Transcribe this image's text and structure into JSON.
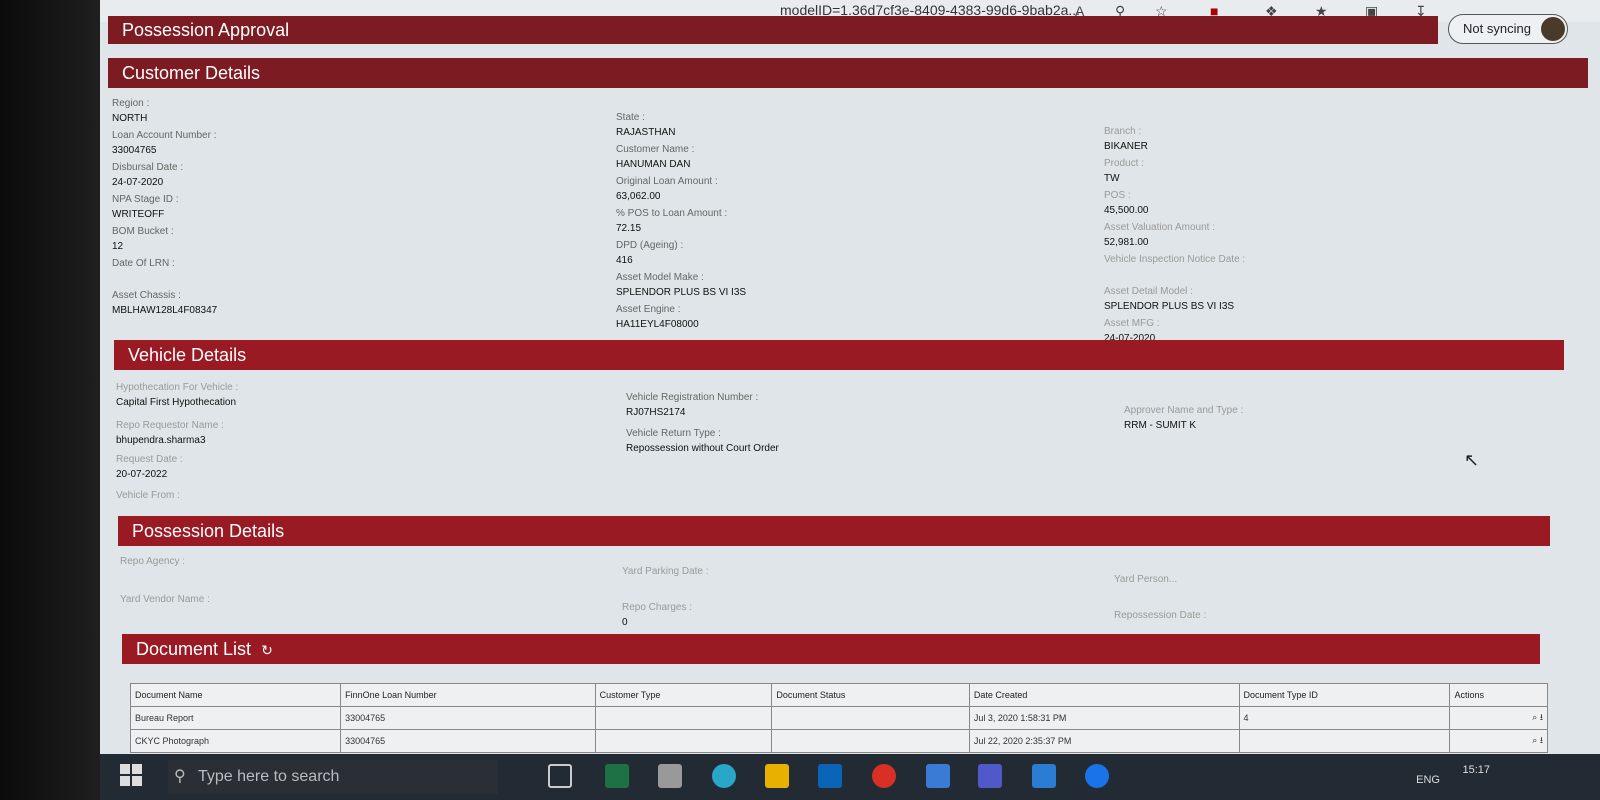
{
  "browser": {
    "url": "modelID=1.36d7cf3e-8409-4383-99d6-9bab2a...",
    "sync_label": "Not syncing"
  },
  "page": {
    "title": "Possession Approval",
    "customer": {
      "header": "Customer Details",
      "col1": [
        [
          "Region :",
          "NORTH"
        ],
        [
          "Loan Account Number :",
          "33004765"
        ],
        [
          "Disbursal Date :",
          "24-07-2020"
        ],
        [
          "NPA Stage ID :",
          "WRITEOFF"
        ],
        [
          "BOM Bucket :",
          "12"
        ],
        [
          "Date Of LRN :",
          ""
        ],
        [
          "Asset Chassis :",
          "MBLHAW128L4F08347"
        ]
      ],
      "col2": [
        [
          "State :",
          "RAJASTHAN"
        ],
        [
          "Customer Name :",
          "HANUMAN DAN"
        ],
        [
          "Original Loan Amount :",
          "63,062.00"
        ],
        [
          "% POS to Loan Amount :",
          "72.15"
        ],
        [
          "DPD (Ageing) :",
          "416"
        ],
        [
          "Asset Model Make :",
          "SPLENDOR PLUS BS VI I3S"
        ],
        [
          "Asset Engine :",
          "HA11EYL4F08000"
        ]
      ],
      "col3": [
        [
          "Branch :",
          "BIKANER"
        ],
        [
          "Product :",
          "TW"
        ],
        [
          "POS :",
          "45,500.00"
        ],
        [
          "Asset Valuation Amount :",
          "52,981.00"
        ],
        [
          "Vehicle Inspection Notice Date :",
          ""
        ],
        [
          "Asset Detail Model :",
          "SPLENDOR PLUS BS VI I3S"
        ],
        [
          "Asset MFG :",
          "24-07-2020"
        ]
      ]
    },
    "vehicle": {
      "header": "Vehicle Details",
      "hyp_label": "Hypothecation For Vehicle :",
      "hyp_value": "Capital First Hypothecation",
      "req_label": "Repo Requestor Name :",
      "req_value": "bhupendra.sharma3",
      "date_label": "Request Date :",
      "date_value": "20-07-2022",
      "from_label": "Vehicle From :",
      "reg_label": "Vehicle Registration Number :",
      "reg_value": "RJ07HS2174",
      "ret_label": "Vehicle Return Type :",
      "ret_value": "Repossession without Court Order",
      "appr_label": "Approver Name and Type :",
      "appr_value": "RRM - SUMIT K"
    },
    "possession": {
      "header": "Possession Details",
      "agency_label": "Repo Agency :",
      "vendor_label": "Yard Vendor Name :",
      "yard_date_label": "Yard Parking Date :",
      "charges_label": "Repo Charges :",
      "charges_value": "0",
      "yard_person_label": "Yard Person...",
      "repo_date_label": "Repossession Date :"
    },
    "documents": {
      "header": "Document List",
      "refresh_icon": "refresh-icon",
      "columns": [
        "Document Name",
        "FinnOne Loan Number",
        "Customer Type",
        "Document Status",
        "Date Created",
        "Document Type ID",
        "Actions"
      ],
      "rows": [
        [
          "Bureau Report",
          "33004765",
          "",
          "",
          "Jul 3, 2020 1:58:31 PM",
          "4",
          ""
        ],
        [
          "CKYC Photograph",
          "33004765",
          "",
          "",
          "Jul 22, 2020 2:35:37 PM",
          "",
          ""
        ]
      ]
    }
  },
  "taskbar": {
    "search_placeholder": "Type here to search",
    "time": "15:17",
    "lang": "ENG"
  }
}
